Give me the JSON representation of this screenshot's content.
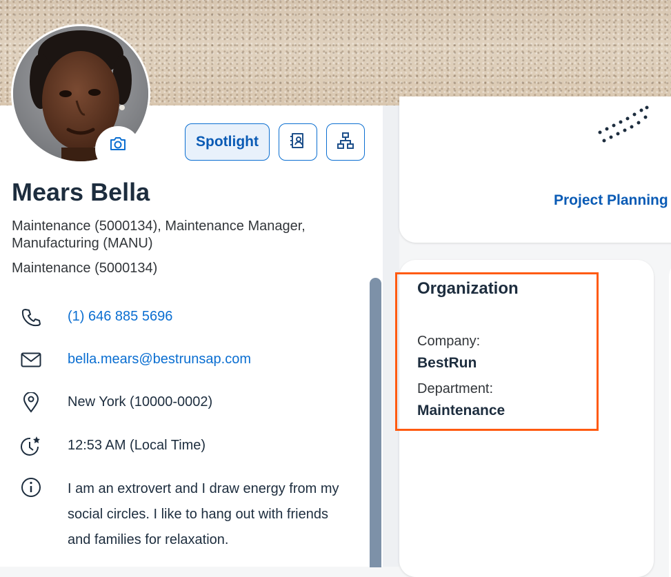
{
  "profile": {
    "name": "Mears Bella",
    "subtitle": "Maintenance (5000134), Maintenance Manager, Manufacturing (MANU)",
    "department_line": "Maintenance (5000134)"
  },
  "actions": {
    "spotlight_label": "Spotlight",
    "card_icon": "contact-card-icon",
    "org_icon": "org-chart-icon",
    "camera_icon": "camera-icon"
  },
  "contact": {
    "phone": "(1) 646 885 5696",
    "email": "bella.mears@bestrunsap.com",
    "location": "New York (10000-0002)",
    "local_time": "12:53 AM (Local Time)",
    "about": "I am an extrovert and I draw energy from my social circles. I like to hang out with friends and families for relaxation."
  },
  "top_card": {
    "link": "Project Planning"
  },
  "organization": {
    "title": "Organization",
    "company_label": "Company:",
    "company_value": "BestRun",
    "department_label": "Department:",
    "department_value": "Maintenance"
  },
  "colors": {
    "link": "#0a6ed1",
    "highlight": "#ff5a10",
    "scrollbar": "#7d91a8"
  }
}
